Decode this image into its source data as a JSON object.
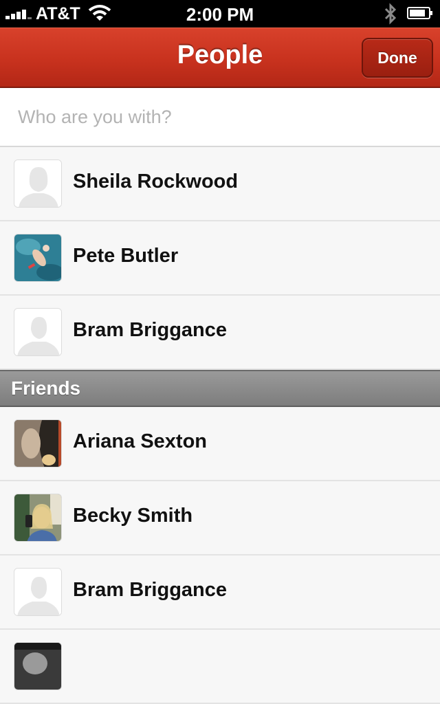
{
  "status_bar": {
    "carrier": "AT&T",
    "time": "2:00 PM",
    "icons": [
      "signal-icon",
      "wifi-icon",
      "bluetooth-icon",
      "battery-icon"
    ]
  },
  "nav": {
    "title": "People",
    "done_label": "Done",
    "accent_color": "#c8321e"
  },
  "search": {
    "placeholder": "Who are you with?",
    "value": ""
  },
  "recent": [
    {
      "name": "Sheila Rockwood",
      "avatar": "female-silhouette-icon"
    },
    {
      "name": "Pete Butler",
      "avatar": "swimmer-photo"
    },
    {
      "name": "Bram Briggance",
      "avatar": "male-silhouette-icon"
    }
  ],
  "friends": {
    "title": "Friends",
    "items": [
      {
        "name": "Ariana Sexton",
        "avatar": "profile-photo"
      },
      {
        "name": "Becky Smith",
        "avatar": "profile-photo"
      },
      {
        "name": "Bram Briggance",
        "avatar": "male-silhouette-icon"
      },
      {
        "name": "",
        "avatar": "profile-photo"
      }
    ]
  }
}
